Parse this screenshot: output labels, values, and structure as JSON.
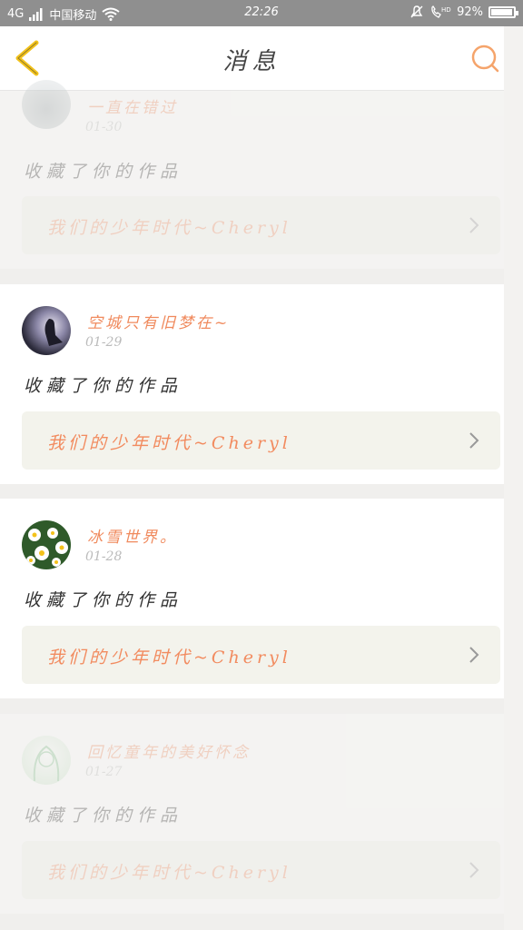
{
  "status_bar": {
    "network": "4G",
    "carrier": "中国移动",
    "time": "22:26",
    "battery": "92%"
  },
  "header": {
    "title": "消息",
    "back_icon": "chevron-left-icon",
    "search_icon": "search-icon"
  },
  "colors": {
    "accent": "#f08a5d",
    "back": "#f2c21b",
    "search": "#f5a46b"
  },
  "messages": [
    {
      "user": "一直在错过",
      "date": "01-30",
      "action": "收藏了你的作品",
      "work": "我们的少年时代~Cheryl"
    },
    {
      "user": "空城只有旧梦在~",
      "date": "01-29",
      "action": "收藏了你的作品",
      "work": "我们的少年时代~Cheryl"
    },
    {
      "user": "冰雪世界。",
      "date": "01-28",
      "action": "收藏了你的作品",
      "work": "我们的少年时代~Cheryl"
    },
    {
      "user": "回忆童年的美好怀念",
      "date": "01-27",
      "action": "收藏了你的作品",
      "work": "我们的少年时代~Cheryl"
    }
  ]
}
